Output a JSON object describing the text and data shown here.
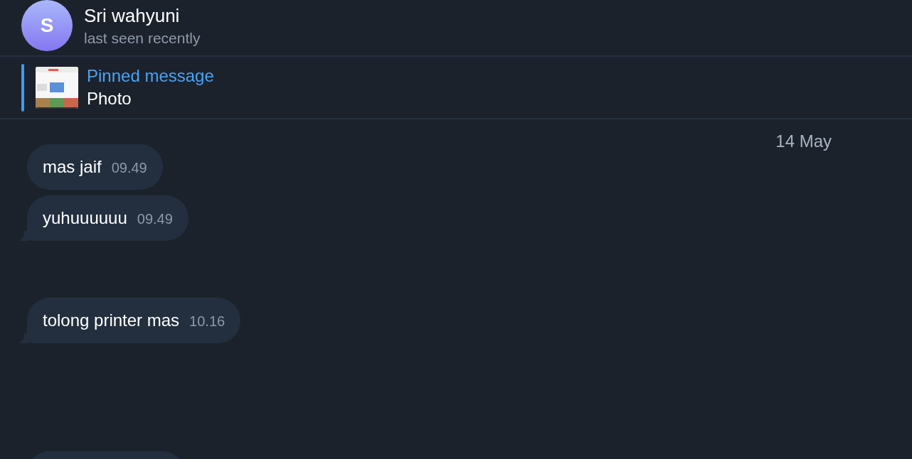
{
  "chat_header": {
    "avatar_letter": "S",
    "name": "Sri wahyuni",
    "status": "last seen recently"
  },
  "pinned": {
    "title": "Pinned message",
    "text": "Photo"
  },
  "date_badge": "14 May",
  "messages": [
    {
      "kind": "text",
      "text": "mas jaif",
      "time": "09.49",
      "tail": false
    },
    {
      "kind": "text",
      "text": "yuhuuuuuu",
      "time": "09.49",
      "tail": true
    },
    {
      "kind": "text",
      "text": "tolong printer mas",
      "time": "10.16",
      "tail": true
    },
    {
      "kind": "cut"
    }
  ]
}
